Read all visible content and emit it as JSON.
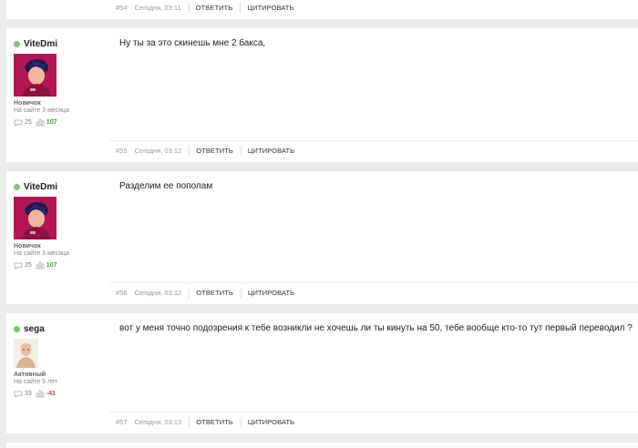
{
  "top_footer": {
    "number": "#54",
    "time": "Сегодня, 03:11",
    "reply_label": "ОТВЕТИТЬ",
    "quote_label": "ЦИТИРОВАТЬ"
  },
  "posts": [
    {
      "author": {
        "name": "ViteDmi",
        "online": true,
        "avatar_icon": "anime-avatar",
        "rank": "Новичок",
        "since": "На сайте 3 месяца",
        "comments_icon": "speech-bubble-icon",
        "comments": "25",
        "reputation_icon": "bar-chart-icon",
        "reputation": "107"
      },
      "message": "Ну ты за это скинешь мне 2 бакса,",
      "footer": {
        "number": "#55",
        "time": "Сегодня, 03:12",
        "reply_label": "ОТВЕТИТЬ",
        "quote_label": "ЦИТИРОВАТЬ"
      }
    },
    {
      "author": {
        "name": "ViteDmi",
        "online": true,
        "avatar_icon": "anime-avatar",
        "rank": "Новичок",
        "since": "На сайте 3 месяца",
        "comments_icon": "speech-bubble-icon",
        "comments": "25",
        "reputation_icon": "bar-chart-icon",
        "reputation": "107"
      },
      "message": "Разделим ее пополам",
      "footer": {
        "number": "#56",
        "time": "Сегодня, 03:12",
        "reply_label": "ОТВЕТИТЬ",
        "quote_label": "ЦИТИРОВАТЬ"
      }
    },
    {
      "author": {
        "name": "sega",
        "online": true,
        "avatar_icon": "portrait-avatar",
        "rank": "Активный",
        "since": "На сайте 9 лет",
        "comments_icon": "speech-bubble-icon",
        "comments": "33",
        "reputation_icon": "bar-chart-icon",
        "reputation": "-41"
      },
      "message": "вот у меня точно подозрения к тебе возникли не хочешь ли ты кинуть на 50, тебе вообще кто-то тут первый переводил ?",
      "footer": {
        "number": "#57",
        "time": "Сегодня, 03:13",
        "reply_label": "ОТВЕТИТЬ",
        "quote_label": "ЦИТИРОВАТЬ"
      }
    }
  ],
  "colors": {
    "online": "#7cc576",
    "reputation_positive": "#4a9a3a",
    "reputation_negative": "#c94040",
    "page_background": "#ebebeb",
    "avatar_background": "#c2185b"
  }
}
